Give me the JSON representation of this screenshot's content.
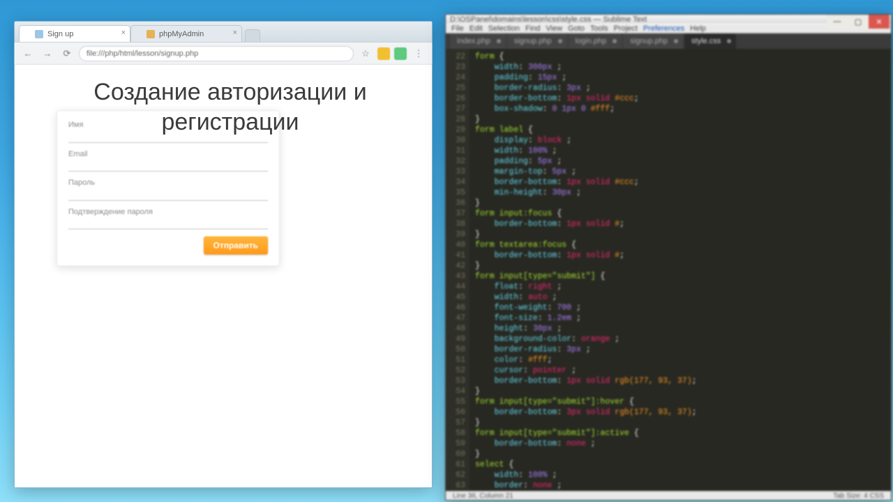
{
  "browser": {
    "tabs": [
      {
        "title": "Sign up",
        "active": true
      },
      {
        "title": "phpMyAdmin",
        "active": false
      }
    ],
    "url": "file:///php/html/lesson/signup.php",
    "extensions": [
      "bookmark",
      "ublock",
      "menu"
    ]
  },
  "overlay": {
    "title_line1": "Создание авторизации и",
    "title_line2": "регистрации"
  },
  "form": {
    "fields": {
      "name": {
        "label": "Имя",
        "value": ""
      },
      "email": {
        "label": "Email",
        "value": ""
      },
      "password": {
        "label": "Пароль",
        "value": ""
      },
      "confirm": {
        "label": "Подтверждение пароля",
        "value": ""
      }
    },
    "submit_label": "Отправить"
  },
  "editor": {
    "titlebar": "D:\\OSPanel\\domains\\lesson\\css\\style.css — Sublime Text",
    "menu": [
      "File",
      "Edit",
      "Selection",
      "Find",
      "View",
      "Goto",
      "Tools",
      "Project",
      "Preferences",
      "Help"
    ],
    "menu_highlight_index": 8,
    "tabs": [
      "index.php",
      "signup.php",
      "login.php",
      "signup.php",
      "style.css"
    ],
    "active_tab_index": 4,
    "status_left": "Line 36, Column 21",
    "status_right": "Tab Size: 4    CSS",
    "gutter_start": 22,
    "gutter_count": 42,
    "code_lines": [
      {
        "sel": "form",
        "open": true
      },
      {
        "prop": "width",
        "valnum": "300px"
      },
      {
        "prop": "padding",
        "valnum": "15px"
      },
      {
        "prop": "border-radius",
        "valnum": "3px"
      },
      {
        "prop": "border-bottom",
        "valkw": "1px solid",
        "valc": "#ccc"
      },
      {
        "prop": "box-shadow",
        "valnum": "0 1px 0",
        "valc": "#fff"
      },
      {
        "close": true
      },
      {
        "sel": "form label",
        "open": true
      },
      {
        "prop": "display",
        "valkw": "block"
      },
      {
        "prop": "width",
        "valnum": "100%"
      },
      {
        "prop": "padding",
        "valnum": "5px"
      },
      {
        "prop": "margin-top",
        "valnum": "5px"
      },
      {
        "prop": "border-bottom",
        "valkw": "1px solid",
        "valc": "#ccc"
      },
      {
        "prop": "min-height",
        "valnum": "30px"
      },
      {
        "close": true
      },
      {
        "sel": "form input:focus",
        "open": true
      },
      {
        "prop": "border-bottom",
        "valkw": "1px solid",
        "valc": "#"
      },
      {
        "close": true
      },
      {
        "sel": "form textarea:focus",
        "open": true
      },
      {
        "prop": "border-bottom",
        "valkw": "1px solid",
        "valc": "#"
      },
      {
        "close": true
      },
      {
        "sel": "form input[type=\"submit\"]",
        "open": true
      },
      {
        "prop": "float",
        "valkw": "right"
      },
      {
        "prop": "width",
        "valkw": "auto"
      },
      {
        "prop": "font-weight",
        "valnum": "700"
      },
      {
        "prop": "font-size",
        "valnum": "1.2em"
      },
      {
        "prop": "height",
        "valnum": "30px"
      },
      {
        "prop": "background-color",
        "valkw": "orange"
      },
      {
        "prop": "border-radius",
        "valnum": "3px"
      },
      {
        "prop": "color",
        "valc": "#fff"
      },
      {
        "prop": "cursor",
        "valkw": "pointer"
      },
      {
        "prop": "border-bottom",
        "valkw": "1px solid",
        "valc": "rgb(177, 93, 37)"
      },
      {
        "close": true
      },
      {
        "sel": "form input[type=\"submit\"]:hover",
        "open": true
      },
      {
        "prop": "border-bottom",
        "valkw": "3px solid",
        "valc": "rgb(177, 93, 37)"
      },
      {
        "close": true
      },
      {
        "sel": "form input[type=\"submit\"]:active",
        "open": true
      },
      {
        "prop": "border-bottom",
        "valkw": "none"
      },
      {
        "close": true
      },
      {
        "sel": "select",
        "open": true
      },
      {
        "prop": "width",
        "valnum": "100%"
      },
      {
        "prop": "border",
        "valkw": "none"
      }
    ]
  }
}
